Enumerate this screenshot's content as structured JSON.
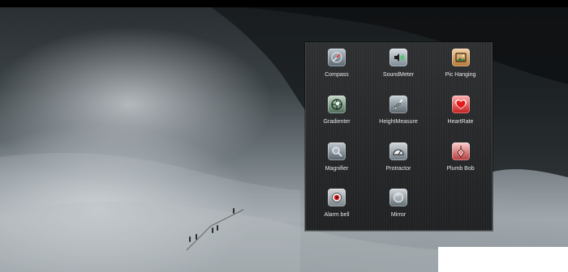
{
  "apps": [
    {
      "label": "Compass",
      "icon": "compass-icon"
    },
    {
      "label": "SoundMeter",
      "icon": "sound-meter-icon"
    },
    {
      "label": "Pic Hanging",
      "icon": "picture-frame-icon"
    },
    {
      "label": "Gradienter",
      "icon": "level-icon"
    },
    {
      "label": "HeightMeasure",
      "icon": "height-measure-icon"
    },
    {
      "label": "HeartRate",
      "icon": "heart-icon"
    },
    {
      "label": "Magnifier",
      "icon": "magnifier-icon"
    },
    {
      "label": "Protractor",
      "icon": "protractor-icon"
    },
    {
      "label": "Plumb Bob",
      "icon": "plumb-bob-icon"
    },
    {
      "label": "Alarm bell",
      "icon": "alarm-bell-icon"
    },
    {
      "label": "Mirror",
      "icon": "mirror-icon"
    }
  ]
}
